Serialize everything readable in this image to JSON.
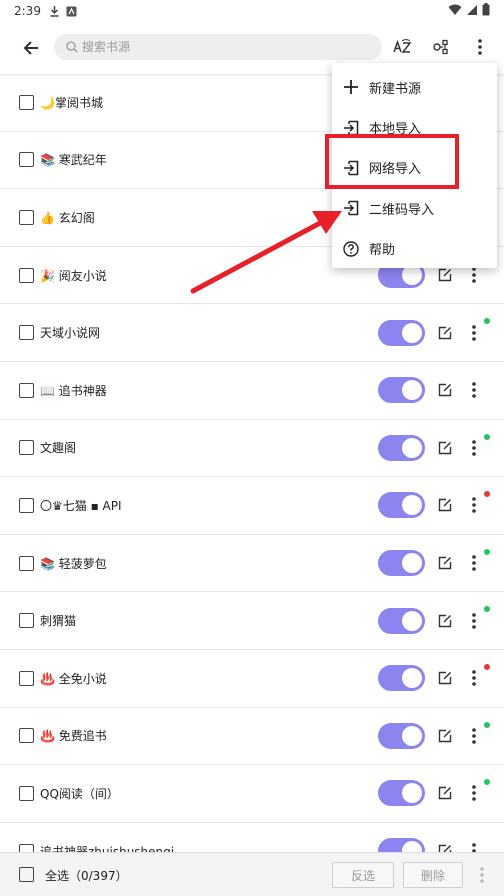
{
  "status_bar": {
    "time": "2:39"
  },
  "toolbar": {
    "search_placeholder": "搜索书源"
  },
  "sources": [
    {
      "name": "🌙掌阅书城",
      "dot": ""
    },
    {
      "name": "📚 寒武纪年",
      "dot": ""
    },
    {
      "name": "👍 玄幻阁",
      "dot": ""
    },
    {
      "name": "🎉 阅友小说",
      "dot": ""
    },
    {
      "name": "天域小说网",
      "dot": "#22c55e"
    },
    {
      "name": "📖 追书神器",
      "dot": ""
    },
    {
      "name": "文趣阁",
      "dot": "#22c55e"
    },
    {
      "name": "〇♛七猫 ▪ API",
      "dot": "#e53935"
    },
    {
      "name": "📚 轻菠萝包",
      "dot": "#22c55e"
    },
    {
      "name": "刺猬猫",
      "dot": "#22c55e"
    },
    {
      "name": "♨️ 全免小说",
      "dot": "#e53935"
    },
    {
      "name": "♨️ 免费追书",
      "dot": "#22c55e"
    },
    {
      "name": "QQ阅读（间）",
      "dot": "#22c55e"
    },
    {
      "name": "追书神器zhuishushenqi",
      "dot": ""
    }
  ],
  "menu": {
    "items": [
      {
        "label": "新建书源",
        "icon": "plus-icon"
      },
      {
        "label": "本地导入",
        "icon": "import-icon"
      },
      {
        "label": "网络导入",
        "icon": "import-icon"
      },
      {
        "label": "二维码导入",
        "icon": "qr-icon"
      },
      {
        "label": "帮助",
        "icon": "help-icon"
      }
    ]
  },
  "bottom_bar": {
    "select_all": "全选（0/397）",
    "invert": "反选",
    "delete": "删除"
  },
  "colors": {
    "toggle_on": "#8c85f0",
    "annotation_red": "#e8202a",
    "dot_green": "#22c55e",
    "dot_red": "#e53935"
  }
}
